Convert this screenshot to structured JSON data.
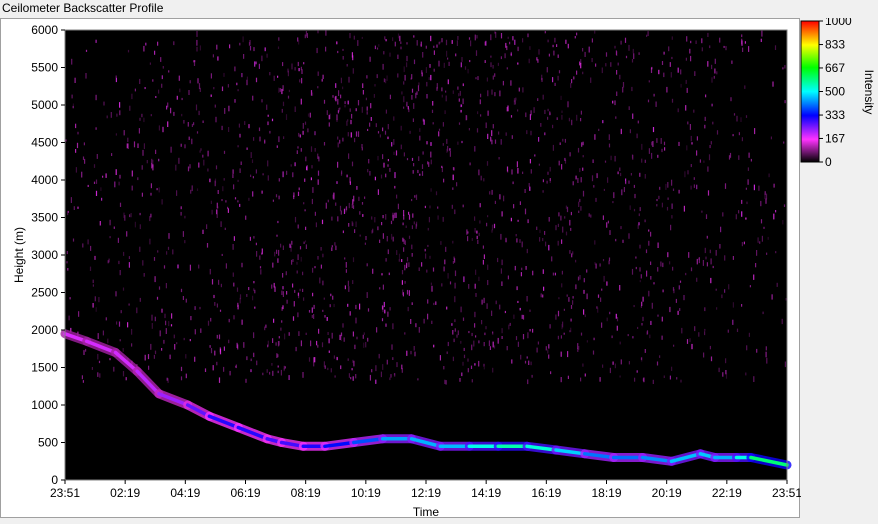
{
  "window": {
    "title": "Ceilometer Backscatter Profile"
  },
  "chart_data": {
    "type": "heatmap",
    "title": "Ceilometer Backscatter Profile",
    "xlabel": "Time",
    "ylabel": "Height (m)",
    "x_ticks": [
      "23:51",
      "02:19",
      "04:19",
      "06:19",
      "08:19",
      "10:19",
      "12:19",
      "14:19",
      "16:19",
      "18:19",
      "20:19",
      "22:19",
      "23:51"
    ],
    "y_ticks": [
      0,
      500,
      1000,
      1500,
      2000,
      2500,
      3000,
      3500,
      4000,
      4500,
      5000,
      5500,
      6000
    ],
    "ylim": [
      0,
      6000
    ],
    "colorbar": {
      "label": "Intensity",
      "range": [
        0,
        1000
      ],
      "ticks": [
        0,
        167,
        333,
        500,
        667,
        833,
        1000
      ],
      "colors": [
        "#000000",
        "#ff33ff",
        "#0000ff",
        "#00ffff",
        "#00ff00",
        "#ffff00",
        "#ff0000"
      ]
    },
    "grid": false,
    "cloud_base_layer": {
      "time_fraction": [
        0.0,
        0.03,
        0.07,
        0.1,
        0.13,
        0.17,
        0.2,
        0.24,
        0.28,
        0.3,
        0.33,
        0.36,
        0.4,
        0.44,
        0.48,
        0.52,
        0.56,
        0.6,
        0.64,
        0.68,
        0.72,
        0.76,
        0.8,
        0.84,
        0.88,
        0.9,
        0.93,
        0.95,
        1.0
      ],
      "height_m": [
        1950,
        1850,
        1700,
        1450,
        1150,
        1000,
        850,
        700,
        550,
        500,
        450,
        450,
        500,
        550,
        550,
        450,
        450,
        450,
        450,
        400,
        350,
        300,
        300,
        250,
        350,
        300,
        300,
        300,
        200
      ],
      "intensity": [
        180,
        200,
        190,
        200,
        220,
        240,
        300,
        320,
        300,
        280,
        300,
        330,
        350,
        420,
        460,
        440,
        470,
        560,
        550,
        500,
        440,
        380,
        430,
        420,
        500,
        430,
        470,
        560,
        620
      ]
    }
  }
}
